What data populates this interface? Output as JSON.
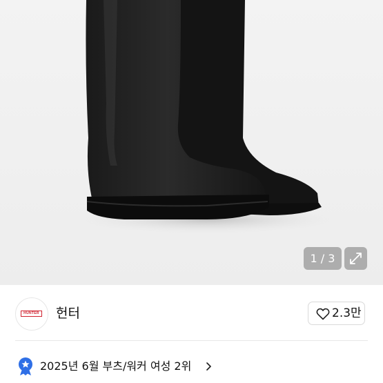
{
  "gallery": {
    "counter": "1 / 3",
    "expand_icon": "expand-icon"
  },
  "brand": {
    "logo_text": "HUNTER",
    "name": "헌터",
    "accent_color": "#d0202e"
  },
  "like": {
    "icon": "heart-outline-icon",
    "count": "2.3만"
  },
  "ranking": {
    "icon": "badge-star-icon",
    "text": "2025년 6월 부츠/워커 여성 2위",
    "chevron": "chevron-right-icon",
    "badge_color": "#2f6fe6"
  }
}
